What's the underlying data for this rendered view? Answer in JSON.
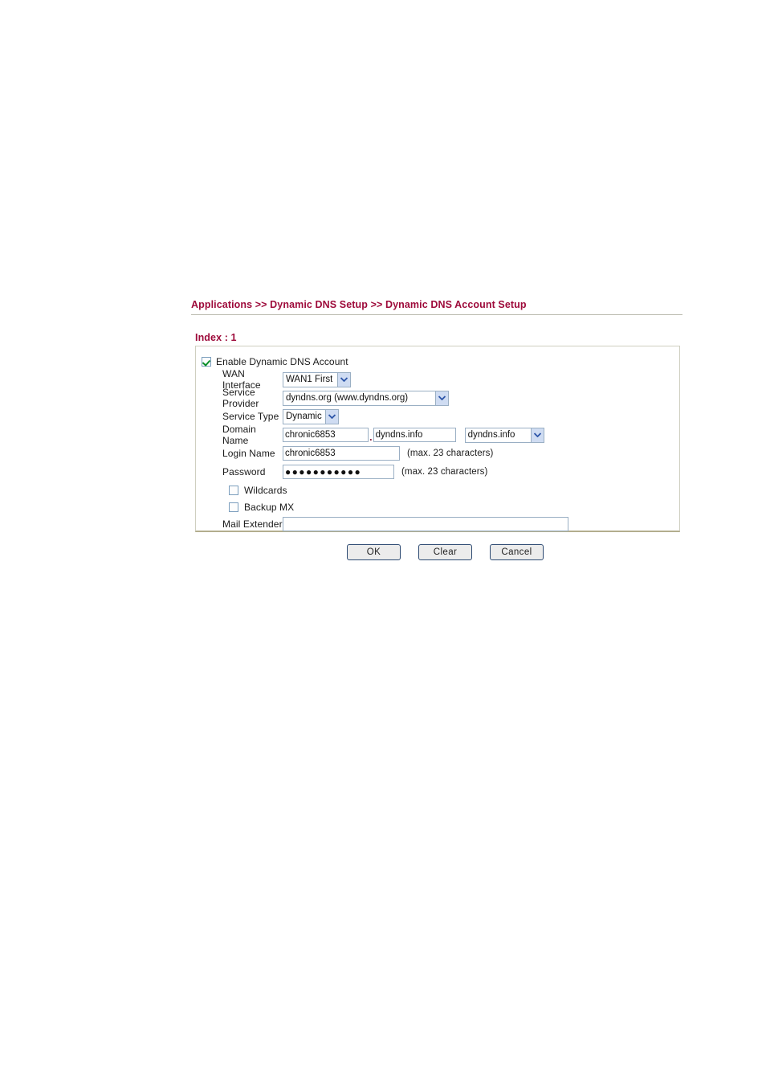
{
  "breadcrumb": {
    "text": "Applications >> Dynamic DNS Setup >> Dynamic DNS Account Setup",
    "color": "#9e0b3b"
  },
  "index_title": "Index : 1",
  "form": {
    "enable": {
      "label": "Enable Dynamic DNS Account",
      "checked": "true"
    },
    "wan_interface": {
      "label": "WAN Interface",
      "value": "WAN1 First"
    },
    "service_provider": {
      "label": "Service Provider",
      "value": "dyndns.org (www.dyndns.org)"
    },
    "service_type": {
      "label": "Service Type",
      "value": "Dynamic"
    },
    "domain_name": {
      "label": "Domain Name",
      "value": "chronic6853",
      "separator": ".",
      "suffix_value": "dyndns.info",
      "suffix_select": "dyndns.info"
    },
    "login_name": {
      "label": "Login Name",
      "value": "chronic6853",
      "hint": "(max. 23 characters)"
    },
    "password": {
      "label": "Password",
      "value": "●●●●●●●●●●●",
      "hint": "(max. 23 characters)"
    },
    "wildcards": {
      "label": "Wildcards",
      "checked": "false"
    },
    "backup_mx": {
      "label": "Backup MX",
      "checked": "false"
    },
    "mail_extender": {
      "label": "Mail Extender",
      "value": ""
    }
  },
  "buttons": {
    "ok": "OK",
    "clear": "Clear",
    "cancel": "Cancel"
  }
}
